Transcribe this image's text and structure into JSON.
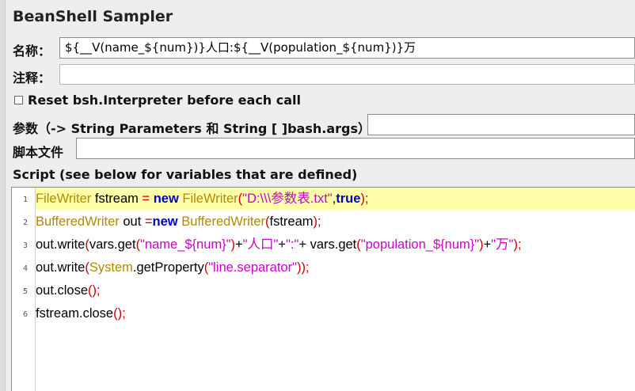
{
  "panel": {
    "title": "BeanShell Sampler"
  },
  "name_field": {
    "label": "名称：",
    "value": "${__V(name_${num})}人口:${__V(population_${num})}万"
  },
  "comment_field": {
    "label": "注释：",
    "value": ""
  },
  "reset_checkbox": {
    "label": "Reset bsh.Interpreter before each call",
    "checked": false
  },
  "parameters_field": {
    "label": "参数（-> String Parameters 和 String [ ]bash.args）",
    "value": ""
  },
  "script_file_field": {
    "label": "脚本文件",
    "value": ""
  },
  "script_section": {
    "label": "Script (see below for variables that are defined)"
  },
  "script": {
    "line_numbers": [
      "1",
      "2",
      "3",
      "4",
      "5",
      "6"
    ],
    "lines": [
      [
        {
          "t": "FileWriter",
          "c": "cl"
        },
        {
          "t": " fstream ",
          "c": ""
        },
        {
          "t": "=",
          "c": "op"
        },
        {
          "t": " ",
          "c": ""
        },
        {
          "t": "new",
          "c": "kw"
        },
        {
          "t": " ",
          "c": ""
        },
        {
          "t": "FileWriter",
          "c": "cl"
        },
        {
          "t": "(",
          "c": "op"
        },
        {
          "t": "\"D:\\\\\\参数表.txt\"",
          "c": "st"
        },
        {
          "t": ",",
          "c": ""
        },
        {
          "t": "true",
          "c": "kw"
        },
        {
          "t": ");",
          "c": "op"
        }
      ],
      [
        {
          "t": "BufferedWriter",
          "c": "cl"
        },
        {
          "t": " out ",
          "c": ""
        },
        {
          "t": "=",
          "c": "op"
        },
        {
          "t": "new",
          "c": "kw"
        },
        {
          "t": " ",
          "c": ""
        },
        {
          "t": "BufferedWriter",
          "c": "cl"
        },
        {
          "t": "(",
          "c": "op"
        },
        {
          "t": "fstream",
          "c": ""
        },
        {
          "t": ");",
          "c": "op"
        }
      ],
      [
        {
          "t": "out.write",
          "c": ""
        },
        {
          "t": "(",
          "c": "op"
        },
        {
          "t": "vars.get",
          "c": ""
        },
        {
          "t": "(",
          "c": "op"
        },
        {
          "t": "\"name_${num}\"",
          "c": "st"
        },
        {
          "t": ")",
          "c": "op"
        },
        {
          "t": "+",
          "c": ""
        },
        {
          "t": "\"人口\"",
          "c": "st"
        },
        {
          "t": "+",
          "c": ""
        },
        {
          "t": "\":\"",
          "c": "st"
        },
        {
          "t": "+ vars.get",
          "c": ""
        },
        {
          "t": "(",
          "c": "op"
        },
        {
          "t": "\"population_${num}\"",
          "c": "st"
        },
        {
          "t": ")",
          "c": "op"
        },
        {
          "t": "+",
          "c": ""
        },
        {
          "t": "\"万\"",
          "c": "st"
        },
        {
          "t": ");",
          "c": "op"
        }
      ],
      [
        {
          "t": "out.write",
          "c": ""
        },
        {
          "t": "(",
          "c": "op"
        },
        {
          "t": "System",
          "c": "cl"
        },
        {
          "t": ".getProperty",
          "c": ""
        },
        {
          "t": "(",
          "c": "op"
        },
        {
          "t": "\"line.separator\"",
          "c": "st"
        },
        {
          "t": "));",
          "c": "op"
        }
      ],
      [
        {
          "t": "out.close",
          "c": ""
        },
        {
          "t": "();",
          "c": "op"
        }
      ],
      [
        {
          "t": "fstream.close",
          "c": ""
        },
        {
          "t": "();",
          "c": "op"
        }
      ]
    ]
  },
  "colors": {
    "keyword": "#0000cc",
    "class": "#b08a00",
    "string": "#cc00cc",
    "operator": "#cc0000",
    "highlight": "#ffffaa"
  }
}
